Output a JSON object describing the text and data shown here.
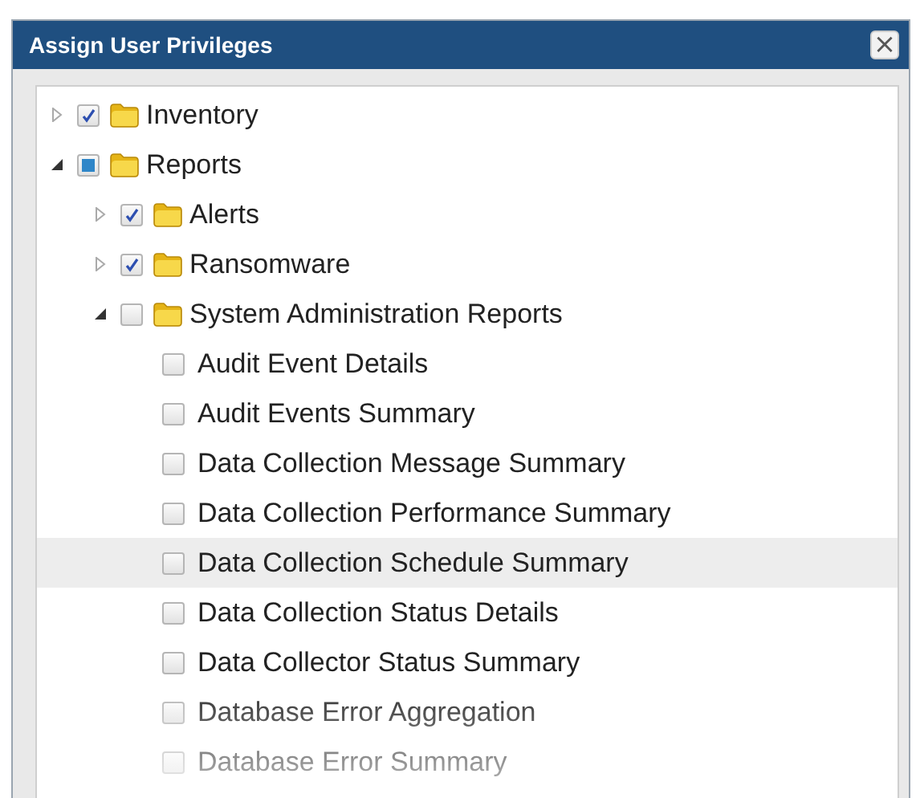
{
  "window": {
    "title": "Assign User Privileges",
    "close_label": "×"
  },
  "tree": [
    {
      "label": "Inventory",
      "kind": "folder",
      "checked": true,
      "expanded": false,
      "selected": false
    },
    {
      "label": "Reports",
      "kind": "folder",
      "checked": false,
      "partial": true,
      "expanded": true,
      "selected": false,
      "children": [
        {
          "label": "Alerts",
          "kind": "folder",
          "checked": true,
          "expanded": false,
          "selected": false
        },
        {
          "label": "Ransomware",
          "kind": "folder",
          "checked": true,
          "expanded": false,
          "selected": false
        },
        {
          "label": "System Administration Reports",
          "kind": "folder",
          "checked": false,
          "expanded": true,
          "selected": false,
          "children": [
            {
              "label": "Audit Event Details",
              "kind": "leaf",
              "checked": false,
              "selected": false
            },
            {
              "label": "Audit Events Summary",
              "kind": "leaf",
              "checked": false,
              "selected": false
            },
            {
              "label": "Data Collection Message Summary",
              "kind": "leaf",
              "checked": false,
              "selected": false
            },
            {
              "label": "Data Collection Performance Summary",
              "kind": "leaf",
              "checked": false,
              "selected": false
            },
            {
              "label": "Data Collection Schedule Summary",
              "kind": "leaf",
              "checked": false,
              "selected": true
            },
            {
              "label": "Data Collection Status Details",
              "kind": "leaf",
              "checked": false,
              "selected": false
            },
            {
              "label": "Data Collector Status Summary",
              "kind": "leaf",
              "checked": false,
              "selected": false
            },
            {
              "label": "Database Error Aggregation",
              "kind": "leaf",
              "checked": false,
              "selected": false
            },
            {
              "label": "Database Error Summary",
              "kind": "leaf",
              "checked": false,
              "selected": false
            }
          ]
        }
      ]
    }
  ]
}
